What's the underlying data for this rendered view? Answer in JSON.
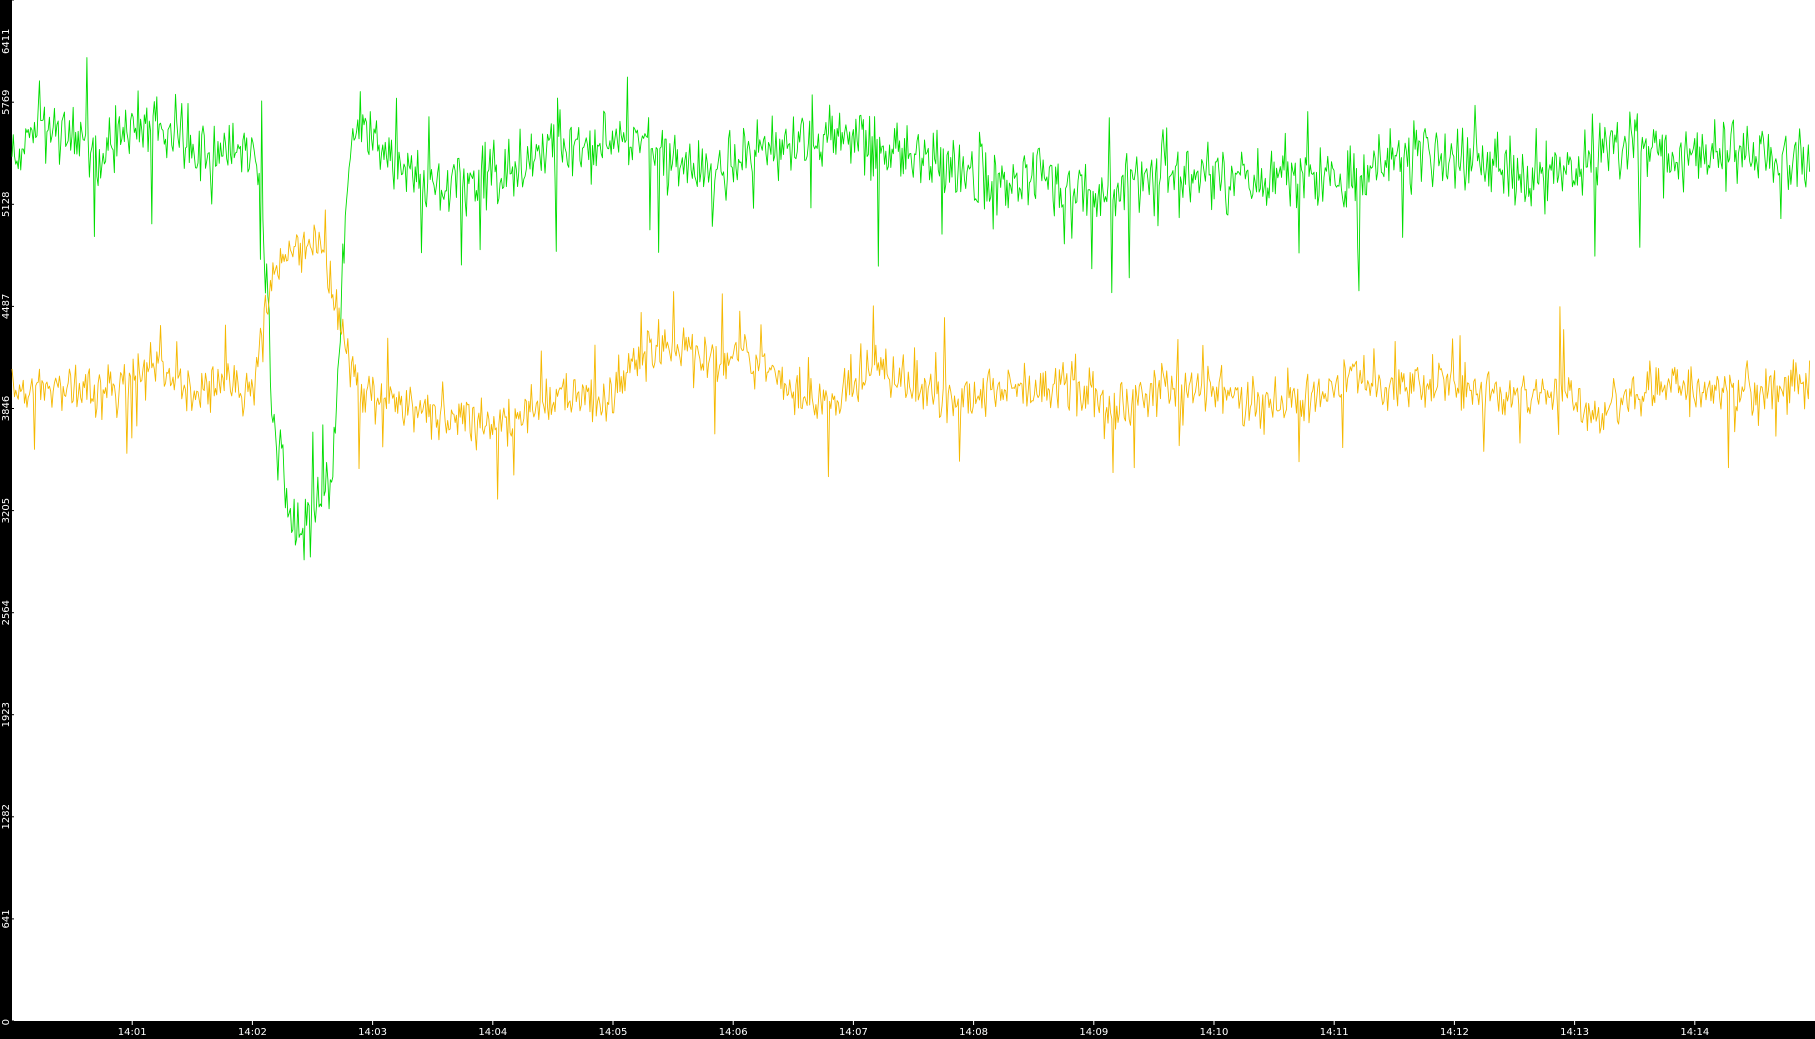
{
  "chart_data": {
    "type": "line",
    "title": "",
    "xlabel": "",
    "ylabel": "",
    "grid": false,
    "legend": "none",
    "x_range": [
      "14:00",
      "14:15"
    ],
    "ylim": [
      0,
      6411
    ],
    "y_ticks": [
      0,
      641,
      1282,
      1923,
      2564,
      3205,
      3846,
      4487,
      5128,
      5769,
      6411
    ],
    "y_tick_labels": [
      "0",
      "641",
      "1282",
      "1923",
      "2564",
      "3205",
      "3846",
      "4487",
      "5128",
      "5769",
      "6411"
    ],
    "x_ticks": [
      "14:01",
      "14:02",
      "14:03",
      "14:04",
      "14:05",
      "14:06",
      "14:07",
      "14:08",
      "14:09",
      "14:10",
      "14:11",
      "14:12",
      "14:13",
      "14:14"
    ],
    "series": [
      {
        "color": "#00dd00",
        "keypoints": [
          [
            "14:00:00",
            5400
          ],
          [
            "14:00:15",
            5650
          ],
          [
            "14:00:30",
            5550
          ],
          [
            "14:00:45",
            5450
          ],
          [
            "14:01:00",
            5600
          ],
          [
            "14:01:15",
            5700
          ],
          [
            "14:01:30",
            5450
          ],
          [
            "14:01:45",
            5500
          ],
          [
            "14:02:00",
            5450
          ],
          [
            "14:02:05",
            5200
          ],
          [
            "14:02:10",
            3800
          ],
          [
            "14:02:20",
            3100
          ],
          [
            "14:02:30",
            3150
          ],
          [
            "14:02:40",
            3400
          ],
          [
            "14:02:48",
            5400
          ],
          [
            "14:02:55",
            5700
          ],
          [
            "14:03:10",
            5350
          ],
          [
            "14:03:30",
            5250
          ],
          [
            "14:03:50",
            5300
          ],
          [
            "14:04:10",
            5400
          ],
          [
            "14:04:30",
            5500
          ],
          [
            "14:04:50",
            5450
          ],
          [
            "14:05:10",
            5550
          ],
          [
            "14:05:30",
            5400
          ],
          [
            "14:05:50",
            5300
          ],
          [
            "14:06:10",
            5450
          ],
          [
            "14:06:30",
            5500
          ],
          [
            "14:06:50",
            5550
          ],
          [
            "14:07:10",
            5500
          ],
          [
            "14:07:30",
            5450
          ],
          [
            "14:07:50",
            5350
          ],
          [
            "14:08:10",
            5200
          ],
          [
            "14:08:30",
            5300
          ],
          [
            "14:08:50",
            5250
          ],
          [
            "14:09:10",
            5200
          ],
          [
            "14:09:30",
            5350
          ],
          [
            "14:09:50",
            5300
          ],
          [
            "14:10:10",
            5250
          ],
          [
            "14:10:30",
            5300
          ],
          [
            "14:10:50",
            5350
          ],
          [
            "14:11:10",
            5250
          ],
          [
            "14:11:30",
            5400
          ],
          [
            "14:11:50",
            5450
          ],
          [
            "14:12:10",
            5400
          ],
          [
            "14:12:30",
            5350
          ],
          [
            "14:12:50",
            5300
          ],
          [
            "14:13:10",
            5450
          ],
          [
            "14:13:30",
            5500
          ],
          [
            "14:13:50",
            5400
          ],
          [
            "14:14:10",
            5450
          ],
          [
            "14:14:30",
            5450
          ],
          [
            "14:14:50",
            5400
          ],
          [
            "14:15:00",
            5350
          ]
        ],
        "noise": 300,
        "spike_up": 500,
        "spike_down": 700
      },
      {
        "color": "#f5b800",
        "keypoints": [
          [
            "14:00:00",
            4000
          ],
          [
            "14:00:15",
            3950
          ],
          [
            "14:00:30",
            4050
          ],
          [
            "14:00:45",
            3900
          ],
          [
            "14:01:00",
            4050
          ],
          [
            "14:01:15",
            4100
          ],
          [
            "14:01:30",
            3950
          ],
          [
            "14:01:45",
            4000
          ],
          [
            "14:02:00",
            3950
          ],
          [
            "14:02:08",
            4600
          ],
          [
            "14:02:20",
            4900
          ],
          [
            "14:02:35",
            4800
          ],
          [
            "14:02:45",
            4300
          ],
          [
            "14:02:55",
            3950
          ],
          [
            "14:03:15",
            3850
          ],
          [
            "14:03:35",
            3800
          ],
          [
            "14:03:55",
            3750
          ],
          [
            "14:04:15",
            3800
          ],
          [
            "14:04:35",
            3950
          ],
          [
            "14:04:55",
            3850
          ],
          [
            "14:05:10",
            4150
          ],
          [
            "14:05:30",
            4250
          ],
          [
            "14:05:50",
            4150
          ],
          [
            "14:06:10",
            4200
          ],
          [
            "14:06:30",
            3900
          ],
          [
            "14:06:50",
            3850
          ],
          [
            "14:07:10",
            4100
          ],
          [
            "14:07:30",
            4000
          ],
          [
            "14:07:50",
            3900
          ],
          [
            "14:08:10",
            3950
          ],
          [
            "14:08:30",
            4000
          ],
          [
            "14:08:50",
            3950
          ],
          [
            "14:09:10",
            3850
          ],
          [
            "14:09:30",
            3950
          ],
          [
            "14:09:50",
            4000
          ],
          [
            "14:10:10",
            3900
          ],
          [
            "14:10:30",
            3850
          ],
          [
            "14:10:50",
            3950
          ],
          [
            "14:11:10",
            4050
          ],
          [
            "14:11:30",
            3950
          ],
          [
            "14:11:50",
            4050
          ],
          [
            "14:12:10",
            3950
          ],
          [
            "14:12:30",
            3900
          ],
          [
            "14:12:50",
            3950
          ],
          [
            "14:13:10",
            3800
          ],
          [
            "14:13:30",
            3950
          ],
          [
            "14:13:50",
            4000
          ],
          [
            "14:14:10",
            3950
          ],
          [
            "14:14:30",
            3950
          ],
          [
            "14:14:50",
            4000
          ],
          [
            "14:15:00",
            3950
          ]
        ],
        "noise": 220,
        "spike_up": 450,
        "spike_down": 550
      }
    ]
  }
}
